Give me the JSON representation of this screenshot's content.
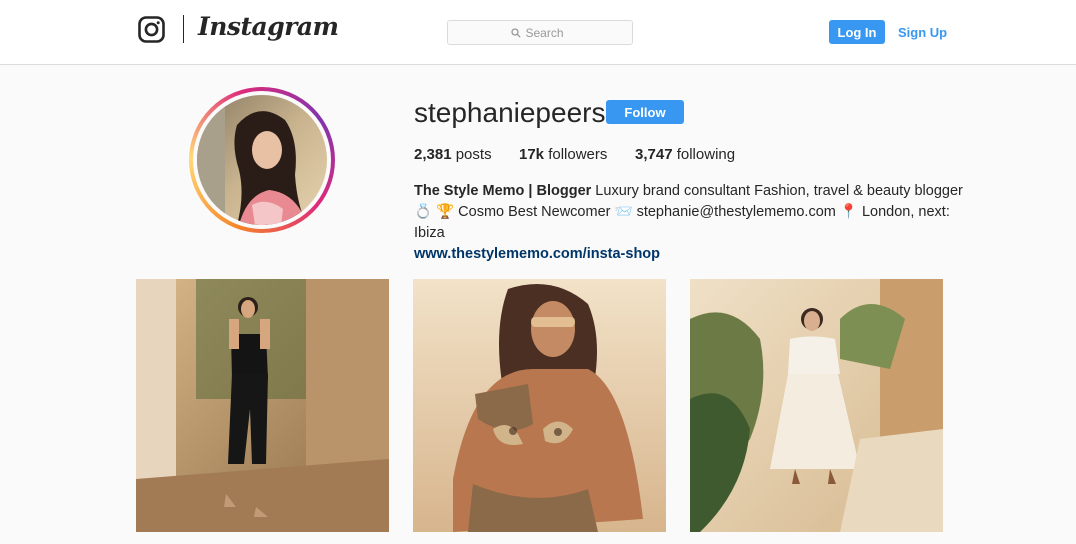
{
  "header": {
    "brand_wordmark": "Instagram",
    "logo_icon": "instagram-camera-icon",
    "search": {
      "placeholder": "Search",
      "icon": "search-icon"
    },
    "login_label": "Log In",
    "signup_label": "Sign Up"
  },
  "profile": {
    "username": "stephaniepeers",
    "follow_label": "Follow",
    "stats": {
      "posts_count": "2,381",
      "posts_label": " posts",
      "followers_count": "17k",
      "followers_label": " followers",
      "following_count": "3,747",
      "following_label": " following"
    },
    "bio": {
      "name": "The Style Memo | Blogger",
      "line1": " Luxury brand consultant Fashion, travel & beauty blogger",
      "line2": "💍 🏆 Cosmo Best Newcomer 📨 stephanie@thestylememo.com 📍 London, next: Ibiza",
      "link": "www.thestylememo.com/insta-shop"
    }
  },
  "posts": [
    {
      "alt": "post-1"
    },
    {
      "alt": "post-2"
    },
    {
      "alt": "post-3"
    }
  ],
  "colors": {
    "accent_blue": "#3897f0",
    "link_navy": "#003569",
    "page_bg": "#fafafa",
    "border": "#dbdbdb"
  }
}
